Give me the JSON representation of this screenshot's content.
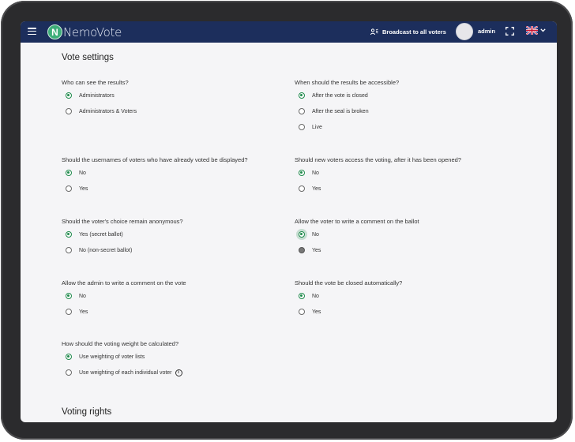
{
  "navbar": {
    "logo_letter": "N",
    "logo_text": "NemoVote",
    "broadcast_label": "Broadcast to all voters",
    "user_name": "admin",
    "language": "EN"
  },
  "vote_settings": {
    "title": "Vote settings",
    "questions": [
      {
        "text": "Who can see the results?",
        "options": [
          "Administrators",
          "Administrators & Voters"
        ],
        "selected": 0
      },
      {
        "text": "When should the results be accessible?",
        "options": [
          "After the vote is closed",
          "After the seal is broken",
          "Live"
        ],
        "selected": 0
      },
      {
        "text": "Should the usernames of voters who have already voted be displayed?",
        "options": [
          "No",
          "Yes"
        ],
        "selected": 0
      },
      {
        "text": "Should new voters access the voting, after it has been opened?",
        "options": [
          "No",
          "Yes"
        ],
        "selected": 0
      },
      {
        "text": "Should the voter's choice remain anonymous?",
        "options": [
          "Yes (secret ballot)",
          "No (non-secret ballot)"
        ],
        "selected": 0
      },
      {
        "text": "Allow the voter to write a comment on the ballot",
        "options": [
          "No",
          "Yes"
        ],
        "selected": 0
      },
      {
        "text": "Allow the admin to write a comment on the vote",
        "options": [
          "No",
          "Yes"
        ],
        "selected": 0
      },
      {
        "text": "Should the vote be closed automatically?",
        "options": [
          "No",
          "Yes"
        ],
        "selected": 0
      },
      {
        "text": "How should the voting weight be calculated?",
        "options": [
          "Use weighting of voter lists",
          "Use weighting of each individual voter"
        ],
        "selected": 0
      }
    ]
  },
  "voting_rights": {
    "title": "Voting rights"
  },
  "colors": {
    "navbar": "#1c2e5c",
    "accent": "#1f8a4c",
    "background": "#f5f5f7"
  },
  "icons": [
    "menu-icon",
    "broadcast-icon",
    "fullscreen-icon",
    "flag-uk-icon",
    "chevron-down-icon",
    "info-icon"
  ]
}
